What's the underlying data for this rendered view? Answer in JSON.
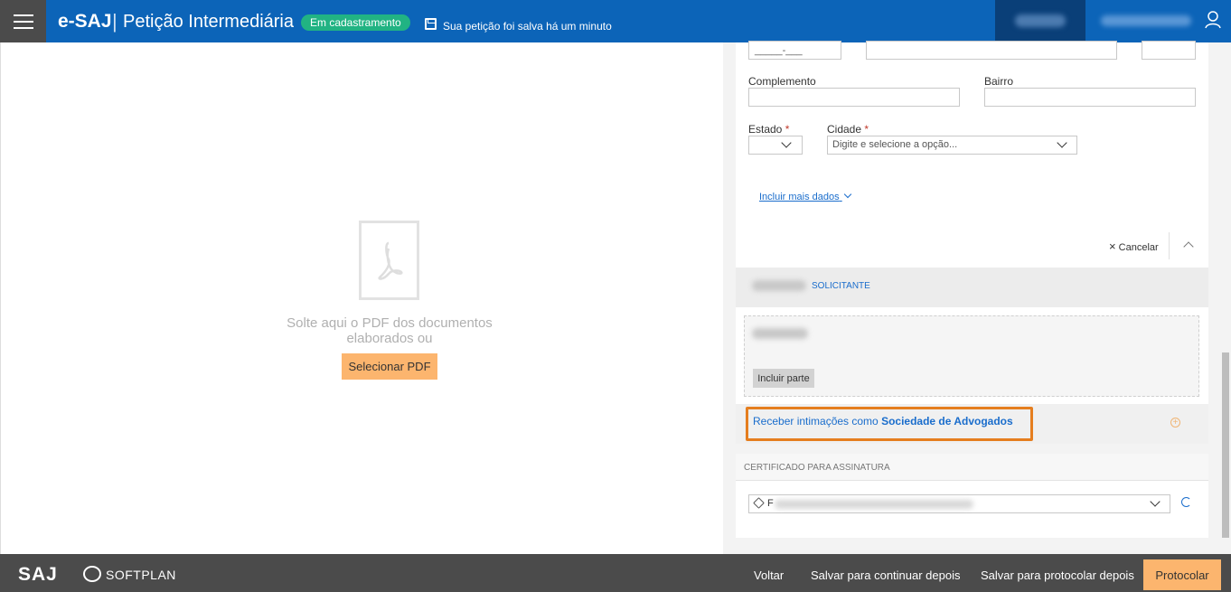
{
  "header": {
    "app_name": "e-SAJ",
    "separator": "|",
    "title": "Petição Intermediária",
    "status_badge": "Em cadastramento",
    "save_status": "Sua petição foi salva há um minuto"
  },
  "drop_area": {
    "text": "Solte aqui o PDF dos documentos elaborados ou",
    "select_button": "Selecionar PDF"
  },
  "address_form": {
    "cep_mask": "_____-___",
    "complement_label": "Complemento",
    "neighborhood_label": "Bairro",
    "state_label": "Estado",
    "city_label": "Cidade",
    "required_mark": "*",
    "city_placeholder": "Digite e selecione a opção...",
    "more_data_link": "Incluir mais dados",
    "cancel_label": "Cancelar"
  },
  "parties": {
    "solicitante_label": "SOLICITANTE",
    "add_party_button": "Incluir parte",
    "intimacao_prefix": "Receber intimações como",
    "intimacao_strong": "Sociedade de Advogados"
  },
  "certificate": {
    "section_title": "CERTIFICADO PARA ASSINATURA",
    "selected_first_char": "F"
  },
  "footer": {
    "saj_logo": "SAJ",
    "softplan_logo": "SOFTPLAN",
    "back": "Voltar",
    "save_continue": "Salvar para continuar depois",
    "save_protocol": "Salvar para protocolar depois",
    "protocol": "Protocolar"
  },
  "colors": {
    "header_bg": "#0c64b8",
    "menu_bg": "#4b4b4b",
    "badge_bg": "#21b383",
    "accent_orange": "#fcb56e",
    "highlight_border": "#e57e1f",
    "link_blue": "#1a6dcc"
  }
}
